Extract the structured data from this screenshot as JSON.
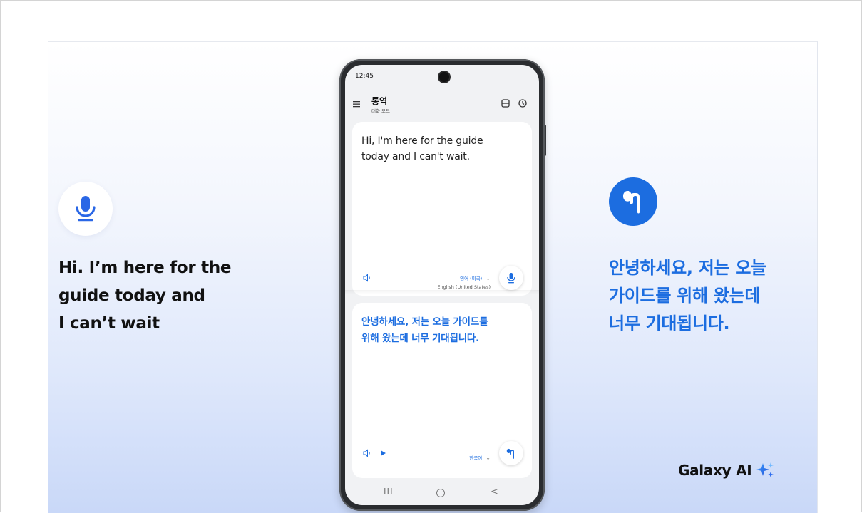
{
  "left_panel": {
    "icon": "microphone-icon",
    "caption_lines": [
      "Hi. I’m here for the",
      "guide today and",
      "I can’t wait"
    ]
  },
  "right_panel": {
    "icon": "earbud-icon",
    "caption_lines": [
      "안녕하세요, 저는 오늘",
      "가이드를 위해 왔는데",
      "너무 기대됩니다."
    ]
  },
  "brand": {
    "name": "Galaxy AI",
    "icon": "sparkle-icon"
  },
  "phone": {
    "status_time": "12:45",
    "app": {
      "title": "통역",
      "subtitle": "대화 모드",
      "icons": [
        "menu-icon",
        "split-screen-icon",
        "history-icon"
      ]
    },
    "top_card": {
      "text_lines": [
        "Hi, I'm here for the guide",
        "today and I can't wait."
      ],
      "language_primary": "영어 (미국)",
      "language_secondary": "English (United States)",
      "button_icon": "microphone-icon"
    },
    "bottom_card": {
      "text_lines": [
        "안녕하세요, 저는 오늘 가이드를",
        "위해 왔는데 너무 기대됩니다."
      ],
      "language_primary": "한국어",
      "button_icon": "earbud-icon"
    },
    "nav": {
      "recent": "III",
      "back": "<"
    }
  },
  "colors": {
    "accent": "#1c6de0",
    "caption_dark": "#111111"
  }
}
